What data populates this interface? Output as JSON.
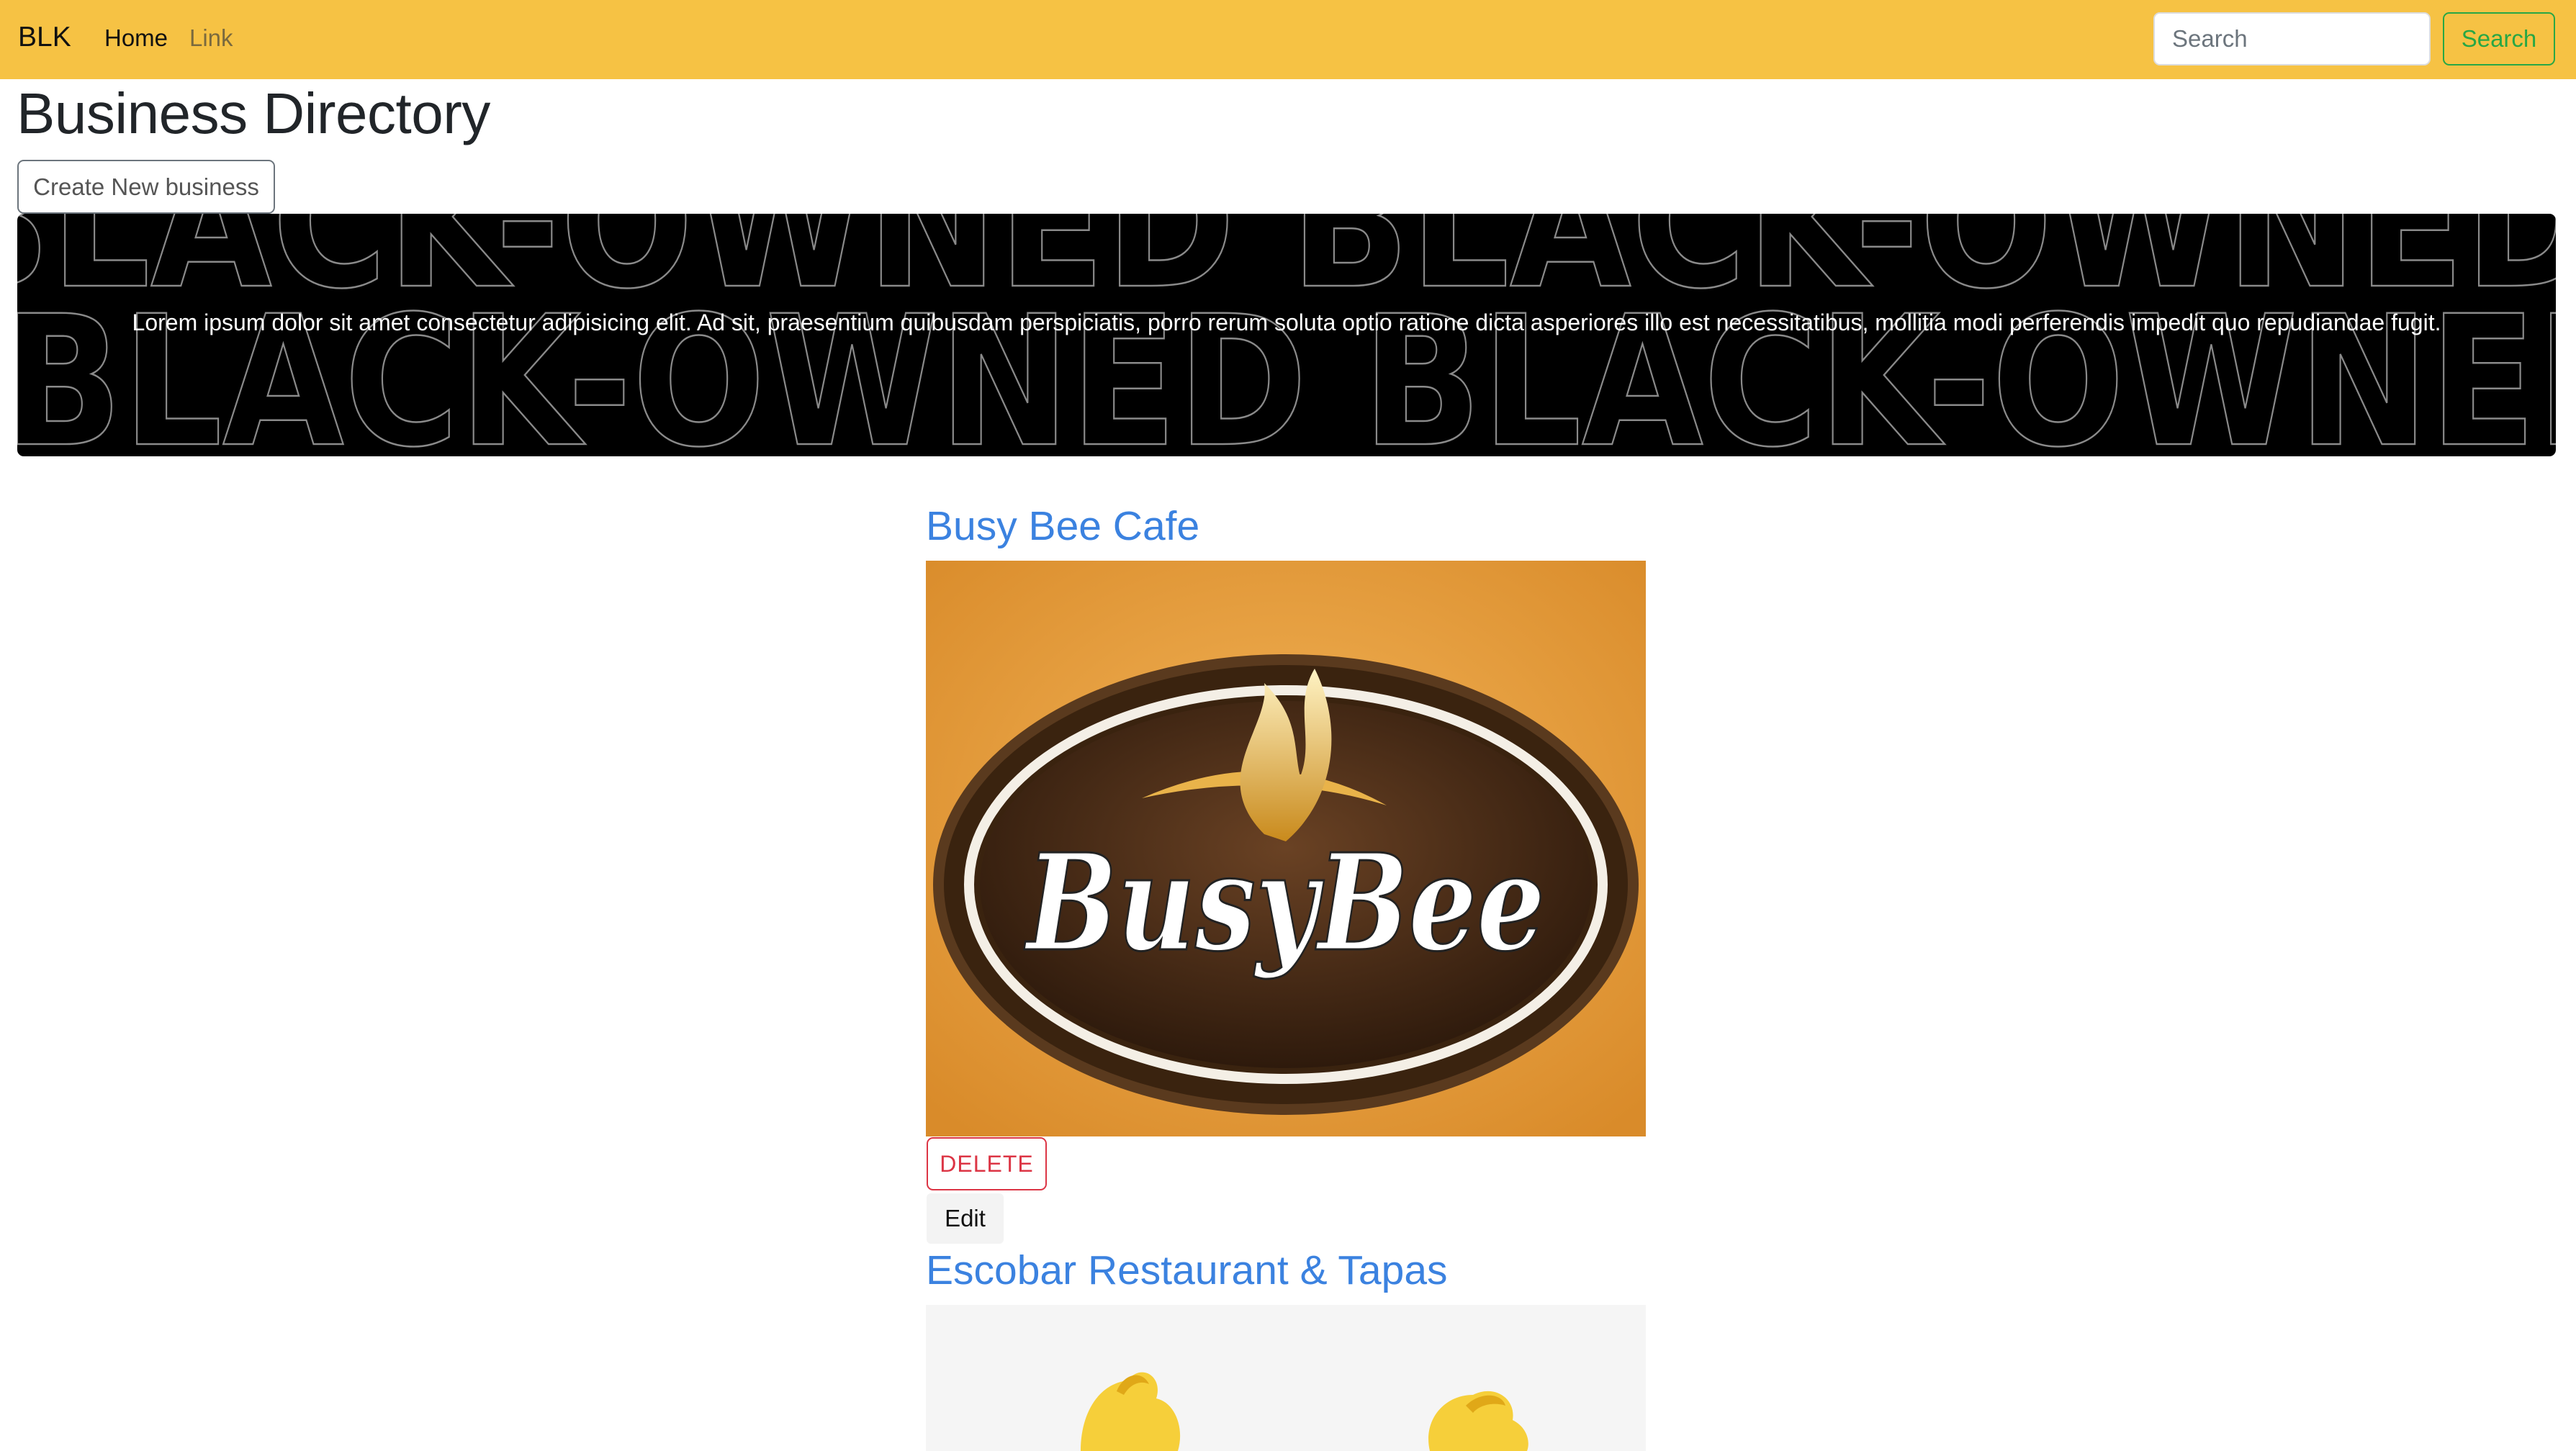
{
  "navbar": {
    "brand": "BLK",
    "links": [
      "Home",
      "Link"
    ],
    "search_placeholder": "Search",
    "search_button": "Search",
    "colors": {
      "background": "#f6c244",
      "search_accent": "#28a745"
    }
  },
  "page": {
    "title": "Business Directory",
    "create_button": "Create New business"
  },
  "hero": {
    "text": "Lorem ipsum dolor sit amet consectetur adipisicing elit. Ad sit, praesentium quibusdam perspiciatis, porro rerum soluta optio ratione dicta asperiores illo est necessitatibus, mollitia modi perferendis impedit quo repudiandae fugit.",
    "background_word": "BLACK-OWNED"
  },
  "businesses": [
    {
      "name": "Busy Bee Cafe",
      "logo_text": "BusyBee",
      "delete_label": "DELETE",
      "edit_label": "Edit"
    },
    {
      "name": "Escobar Restaurant & Tapas"
    }
  ],
  "colors": {
    "link": "#3b82e0",
    "danger": "#dc3545",
    "hero_bg": "#000000"
  }
}
